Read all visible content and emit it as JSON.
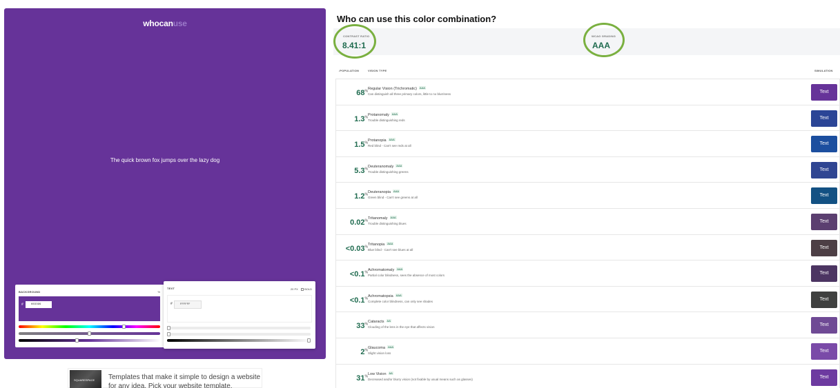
{
  "logo": {
    "who": "who",
    "can": "can",
    "use": "use"
  },
  "preview": {
    "sample_text": "The quick brown fox jumps over the lazy dog"
  },
  "background_picker": {
    "label": "BACKGROUND",
    "format": "%",
    "hash": "#",
    "value": "663399"
  },
  "text_picker": {
    "label": "TEXT",
    "size": "20",
    "unit": "PX",
    "bold_label": "BOLD",
    "hash": "#",
    "value": "FFFFFF"
  },
  "ad": {
    "thumb_text": "SQUARESPACE",
    "line1": "Templates that make it simple to design a website",
    "line2": "for any idea. Pick your website template."
  },
  "heading": "Who can use this color combination?",
  "summary": {
    "contrast_label": "CONTRAST RATIO",
    "contrast_value": "8.41:1",
    "wcag_label": "WCAG GRADING",
    "wcag_value": "AAA"
  },
  "columns": {
    "population": "↓POPULATION",
    "vision": "VISION TYPE",
    "simulation": "SIMULATION"
  },
  "rows": [
    {
      "pct": "68",
      "name": "Regular Vision (Trichromatic)",
      "grade": "AAA",
      "desc": "Can distinguish all three primary colors, little to no blurriness",
      "sim_label": "Text",
      "sim_color": "#663399"
    },
    {
      "pct": "1.3",
      "name": "Protanomaly",
      "grade": "AAA",
      "desc": "Trouble distinguishing reds",
      "sim_label": "Text",
      "sim_color": "#2b4596"
    },
    {
      "pct": "1.5",
      "name": "Protanopia",
      "grade": "AAA",
      "desc": "Red blind - Can't see reds at all",
      "sim_label": "Text",
      "sim_color": "#1c4f9f"
    },
    {
      "pct": "5.3",
      "name": "Deuteranomaly",
      "grade": "AAA",
      "desc": "Trouble distinguishing greens",
      "sim_label": "Text",
      "sim_color": "#2f4592"
    },
    {
      "pct": "1.2",
      "name": "Deuteranopia",
      "grade": "AAA",
      "desc": "Green blind - Can't see greens at all",
      "sim_label": "Text",
      "sim_color": "#135183"
    },
    {
      "pct": "0.02",
      "name": "Tritanomaly",
      "grade": "AAA",
      "desc": "Trouble distinguishing blues",
      "sim_label": "Text",
      "sim_color": "#5b3f70"
    },
    {
      "pct": "<0.03",
      "name": "Tritanopia",
      "grade": "AAA",
      "desc": "Blue blind - Can't see blues at all",
      "sim_label": "Text",
      "sim_color": "#4d3f45"
    },
    {
      "pct": "<0.1",
      "name": "Achromatomaly",
      "grade": "AAA",
      "desc": "Partial color blindness, sees the absence of most colors",
      "sim_label": "Text",
      "sim_color": "#4c3562"
    },
    {
      "pct": "<0.1",
      "name": "Achromatopsia",
      "grade": "AAA",
      "desc": "Complete color blindness, can only see shades",
      "sim_label": "Text",
      "sim_color": "#3f403f"
    },
    {
      "pct": "33",
      "name": "Cataracts",
      "grade": "AA",
      "desc": "Clouding of the lens in the eye that affects vision",
      "sim_label": "Text",
      "sim_color": "#6f4a95"
    },
    {
      "pct": "2",
      "name": "Glaucoma",
      "grade": "AAA",
      "desc": "Slight vision loss",
      "sim_label": "Text",
      "sim_color": "#7a4aa8"
    },
    {
      "pct": "31",
      "name": "Low Vision",
      "grade": "AA",
      "desc": "Decreased and/or blurry vision (not fixable by usual means such as glasses)",
      "sim_label": "Text",
      "sim_color": "#6d3aa0"
    }
  ],
  "colors": {
    "brand": "#663399",
    "grade_green": "#1f6b4f",
    "annotation_circle": "#7ab040"
  }
}
